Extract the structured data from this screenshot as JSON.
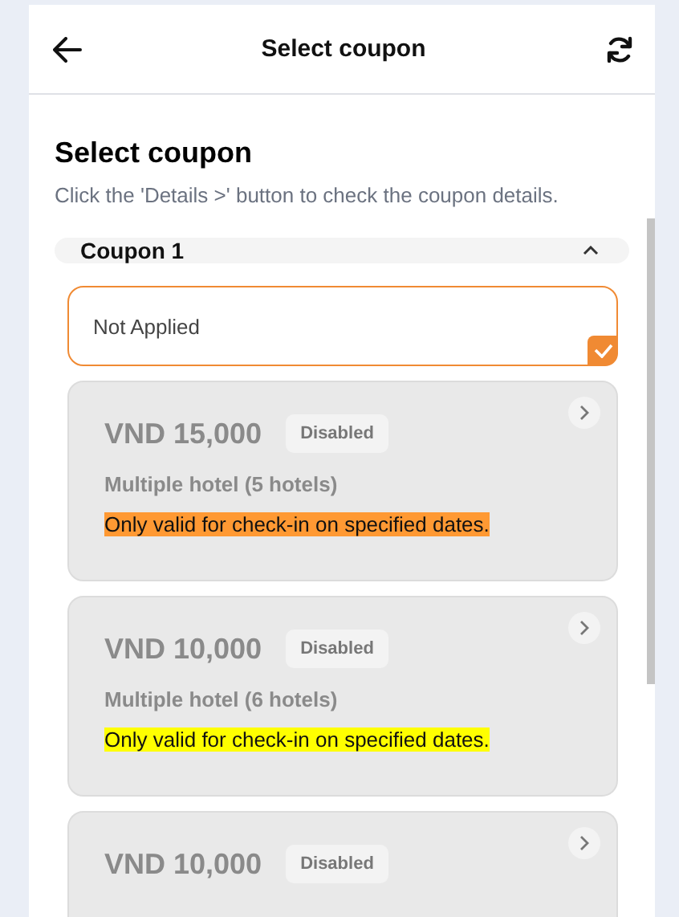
{
  "header": {
    "title": "Select coupon"
  },
  "heading": "Select coupon",
  "hint": "Click the 'Details >' button to check the coupon details.",
  "group": {
    "title": "Coupon 1",
    "expanded": true
  },
  "options": [
    {
      "kind": "none",
      "label": "Not Applied",
      "selected": true
    },
    {
      "kind": "coupon",
      "amount": "VND 15,000",
      "badge": "Disabled",
      "scope": "Multiple hotel (5 hotels)",
      "note": "Only valid for check-in on specified dates.",
      "color": "#ff9933",
      "selected": false,
      "disabled": true
    },
    {
      "kind": "coupon",
      "amount": "VND 10,000",
      "badge": "Disabled",
      "scope": "Multiple hotel (6 hotels)",
      "note": "Only valid for check-in on specified dates.",
      "color": "#ffff00",
      "selected": false,
      "disabled": true
    },
    {
      "kind": "coupon",
      "amount": "VND 10,000",
      "badge": "Disabled",
      "selected": false,
      "disabled": true
    }
  ]
}
